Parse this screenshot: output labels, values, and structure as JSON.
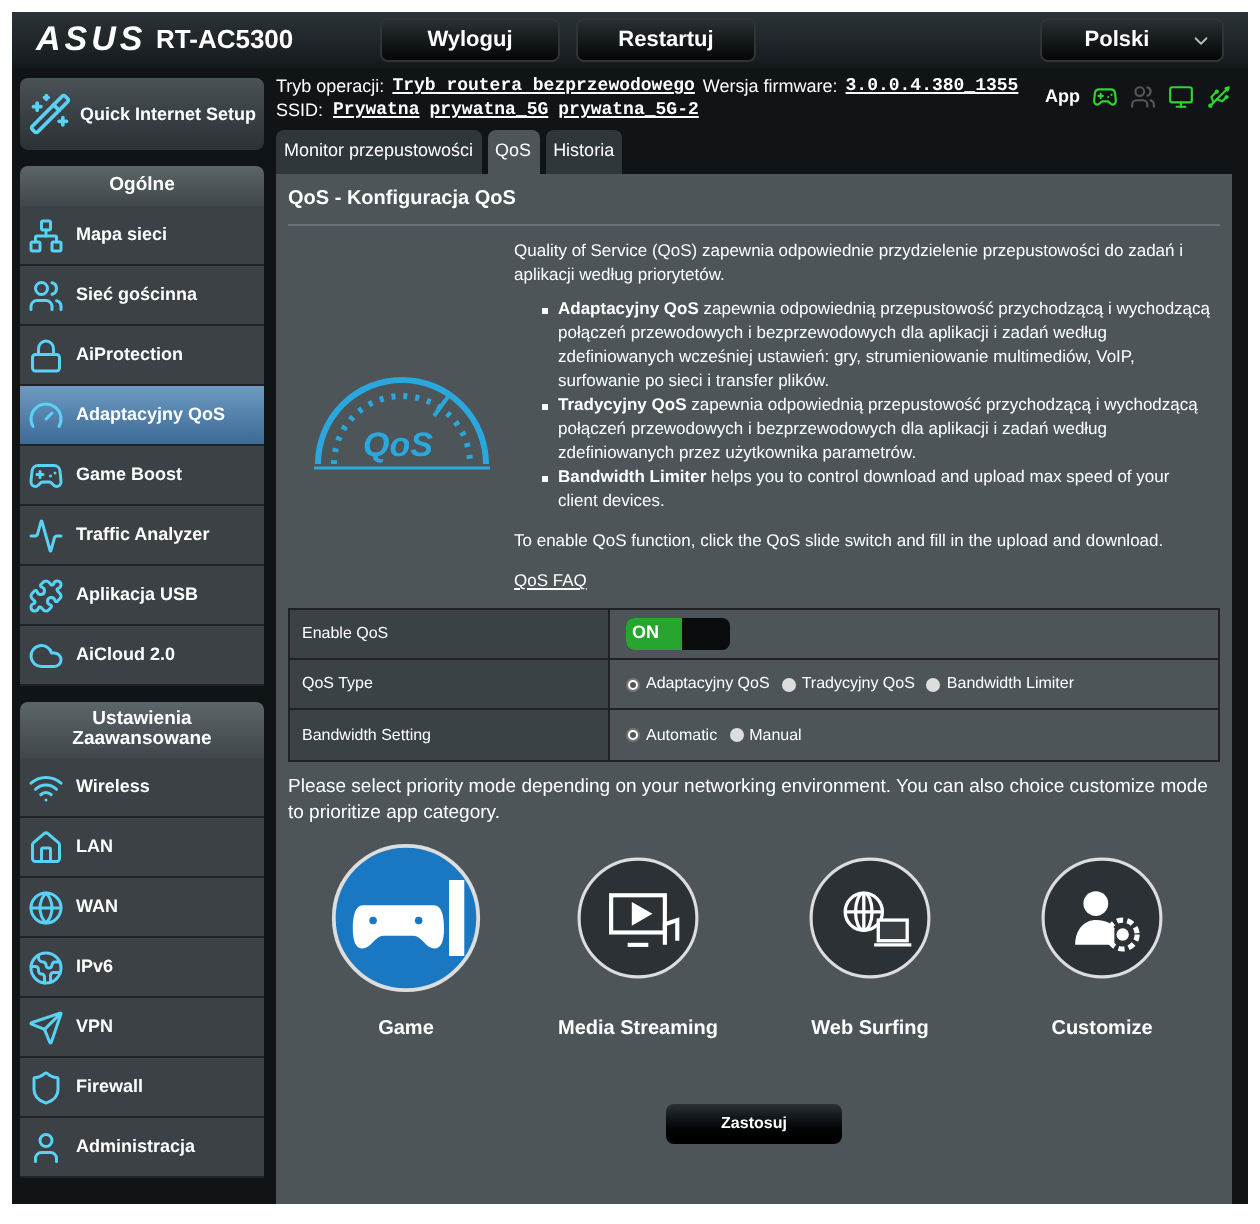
{
  "header": {
    "logo": "ASUS",
    "model": "RT-AC5300",
    "buttons": [
      "Wyloguj",
      "Restartuj"
    ],
    "language": "Polski"
  },
  "info": {
    "mode_label": "Tryb operacji:",
    "mode_value": "Tryb routera bezprzewodowego",
    "firmware_label": "Wersja firmware:",
    "firmware_value": "3.0.0.4.380_1355",
    "ssid_label": "SSID:",
    "ssids": [
      "Prywatna",
      "prywatna_5G",
      "prywatna_5G-2"
    ],
    "app_label": "App"
  },
  "status_icons": [
    {
      "kind": "gamepad",
      "active": true
    },
    {
      "kind": "users",
      "active": false
    },
    {
      "kind": "monitor",
      "active": true
    },
    {
      "kind": "usb",
      "active": true
    }
  ],
  "quick_setup": "Quick Internet Setup",
  "sidebar": [
    {
      "title": "Ogólne",
      "items": [
        {
          "label": "Mapa sieci",
          "kind": "network",
          "selected": false
        },
        {
          "label": "Sieć gościnna",
          "kind": "users",
          "selected": false
        },
        {
          "label": "AiProtection",
          "kind": "lock",
          "selected": false
        },
        {
          "label": "Adaptacyjny QoS",
          "kind": "gauge",
          "selected": true
        },
        {
          "label": "Game Boost",
          "kind": "gamepad",
          "selected": false
        },
        {
          "label": "Traffic Analyzer",
          "kind": "activity",
          "selected": false
        },
        {
          "label": "Aplikacja USB",
          "kind": "puzzle",
          "selected": false
        },
        {
          "label": "AiCloud 2.0",
          "kind": "cloud",
          "selected": false
        }
      ]
    },
    {
      "title": "Ustawienia Zaawansowane",
      "items": [
        {
          "label": "Wireless",
          "kind": "wifi",
          "selected": false
        },
        {
          "label": "LAN",
          "kind": "home",
          "selected": false
        },
        {
          "label": "WAN",
          "kind": "globe",
          "selected": false
        },
        {
          "label": "IPv6",
          "kind": "globe2",
          "selected": false
        },
        {
          "label": "VPN",
          "kind": "send",
          "selected": false
        },
        {
          "label": "Firewall",
          "kind": "shield",
          "selected": false
        },
        {
          "label": "Administracja",
          "kind": "user",
          "selected": false
        }
      ]
    }
  ],
  "tabs": [
    {
      "label": "Monitor przepustowości",
      "selected": false
    },
    {
      "label": "QoS",
      "selected": true
    },
    {
      "label": "Historia",
      "selected": false
    }
  ],
  "panel": {
    "title": "QoS - Konfiguracja QoS",
    "logo_text": "QoS",
    "intro": "Quality of Service (QoS) zapewnia odpowiednie przydzielenie przepustowości do zadań i aplikacji według priorytetów.",
    "bullets": [
      "**Adaptacyjny QoS** zapewnia odpowiednią przepustowość przychodzącą i wychodzącą połączeń przewodowych i bezprzewodowych dla aplikacji i zadań według zdefiniowanych wcześniej ustawień: gry, strumieniowanie multimediów, VoIP, surfowanie po sieci i transfer plików.",
      "**Tradycyjny QoS** zapewnia odpowiednią przepustowość przychodzącą i wychodzącą połączeń przewodowych i bezprzewodowych dla aplikacji i zadań według zdefiniowanych przez użytkownika parametrów.",
      "**Bandwidth Limiter** helps you to control download and upload max speed of your client devices."
    ],
    "enable_note": "To enable QoS function, click the QoS slide switch and fill in the upload and download.",
    "faq_link": "QoS FAQ",
    "settings": [
      {
        "kind": "toggle",
        "label": "Enable QoS",
        "on": true,
        "on_text": "ON"
      },
      {
        "kind": "radio",
        "label": "QoS Type",
        "options": [
          {
            "label": "Adaptacyjny QoS",
            "selected": true
          },
          {
            "label": "Tradycyjny QoS",
            "selected": false
          },
          {
            "label": "Bandwidth Limiter",
            "selected": false
          }
        ]
      },
      {
        "kind": "radio",
        "label": "Bandwidth Setting",
        "options": [
          {
            "label": "Automatic",
            "selected": true
          },
          {
            "label": "Manual",
            "selected": false
          }
        ]
      }
    ],
    "priority_note": "Please select priority mode depending on your networking environment. You can also choice customize mode to prioritize app category.",
    "modes": [
      {
        "label": "Game",
        "kind": "game",
        "selected": true
      },
      {
        "label": "Media Streaming",
        "kind": "media",
        "selected": false
      },
      {
        "label": "Web Surfing",
        "kind": "web",
        "selected": false
      },
      {
        "label": "Customize",
        "kind": "custom",
        "selected": false
      }
    ],
    "apply": "Zastosuj"
  }
}
